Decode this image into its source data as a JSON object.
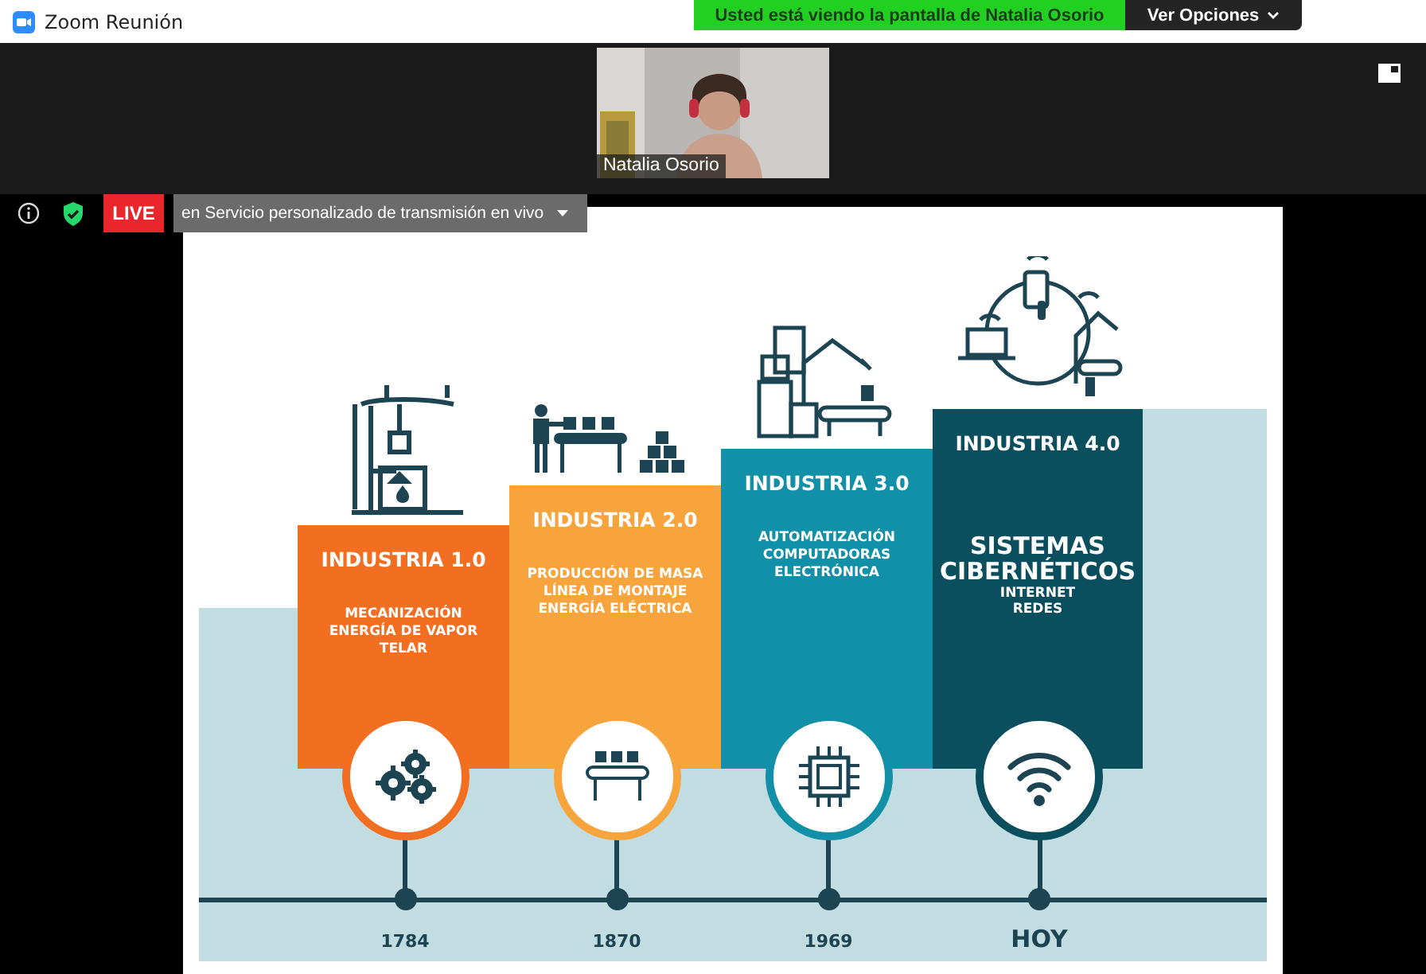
{
  "window": {
    "title": "Zoom Reunión"
  },
  "share_banner": {
    "text": "Usted está viendo la pantalla de Natalia Osorio",
    "options_button": "Ver Opciones"
  },
  "participant": {
    "name": "Natalia Osorio",
    "kind": "picture"
  },
  "live": {
    "badge": "LIVE",
    "service": "en Servicio personalizado de transmisión en vivo"
  },
  "slide": {
    "stages": [
      {
        "kind": "steam",
        "title": "INDUSTRIA 1.0",
        "description": "MECANIZACIÓN\nENERGÍA DE VAPOR\nTELAR",
        "year": "1784",
        "color": "#f26f21",
        "emphasis": false
      },
      {
        "kind": "mass",
        "title": "INDUSTRIA 2.0",
        "description": "PRODUCCIÓN DE MASA\nLÍNEA DE MONTAJE\nENERGÍA ELÉCTRICA",
        "year": "1870",
        "color": "#f7a43c",
        "emphasis": false
      },
      {
        "kind": "automation",
        "title": "INDUSTRIA 3.0",
        "description": "AUTOMATIZACIÓN\nCOMPUTADORAS\nELECTRÓNICA",
        "year": "1969",
        "color": "#1190a8",
        "emphasis": false
      },
      {
        "kind": "cyber",
        "title": "INDUSTRIA 4.0",
        "headline": "SISTEMAS\nCIBERNÉTICOS",
        "description": "INTERNET\nREDES",
        "year": "HOY",
        "color": "#0b4f5f",
        "emphasis": true
      }
    ]
  }
}
